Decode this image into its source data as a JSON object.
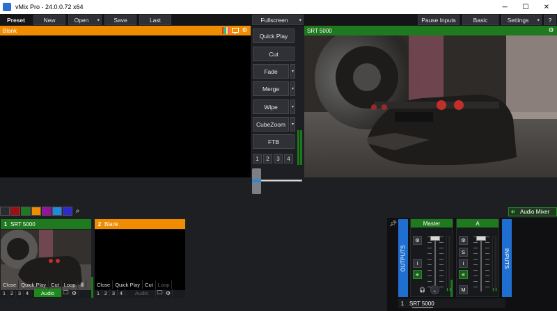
{
  "window": {
    "title": "vMix Pro - 24.0.0.72 x64",
    "min": "─",
    "max": "☐",
    "close": "✕"
  },
  "toolbar": {
    "preset": "Preset",
    "new": "New",
    "open": "Open",
    "save": "Save",
    "last": "Last",
    "fullscreen": "Fullscreen",
    "pause_inputs": "Pause Inputs",
    "basic": "Basic",
    "settings": "Settings",
    "help": "?"
  },
  "preview": {
    "title": "Blank"
  },
  "output": {
    "title": "SRT  5000"
  },
  "transitions": {
    "quick_play": "Quick Play",
    "cut": "Cut",
    "fade": "Fade",
    "merge": "Merge",
    "wipe": "Wipe",
    "cubezoom": "CubeZoom",
    "ftb": "FTB",
    "numbers": [
      "1",
      "2",
      "3",
      "4"
    ]
  },
  "color_filters": [
    "#2a2b2e",
    "#a01010",
    "#1f7a1f",
    "#f08c00",
    "#9a10a0",
    "#1e8ae0",
    "#2a2ad0"
  ],
  "audio_mixer_label": "Audio Mixer",
  "inputs": [
    {
      "number": "1",
      "name": "SRT  5000",
      "header_color": "#1f7a1f",
      "buttons": [
        "Close",
        "Quick Play",
        "Cut",
        "Loop"
      ],
      "pause": "II",
      "nums": [
        "1",
        "2",
        "3",
        "4"
      ],
      "audio": "Audio"
    },
    {
      "number": "2",
      "name": "Blank",
      "header_color": "#f08c00",
      "buttons": [
        "Close",
        "Quick Play",
        "Cut",
        "Loop"
      ],
      "nums": [
        "1",
        "2",
        "3",
        "4"
      ],
      "audio": "Audio"
    }
  ],
  "mixer": {
    "outputs_label": "OUTPUTS",
    "inputs_label": "INPUTS",
    "master": {
      "title": "Master",
      "i": "i",
      "meter_level": 0.05
    },
    "a": {
      "title": "A",
      "s": "S",
      "i": "i",
      "m": "M",
      "meter_level": 0.05
    },
    "input_row": {
      "number": "1",
      "name": "SRT  5000"
    }
  }
}
